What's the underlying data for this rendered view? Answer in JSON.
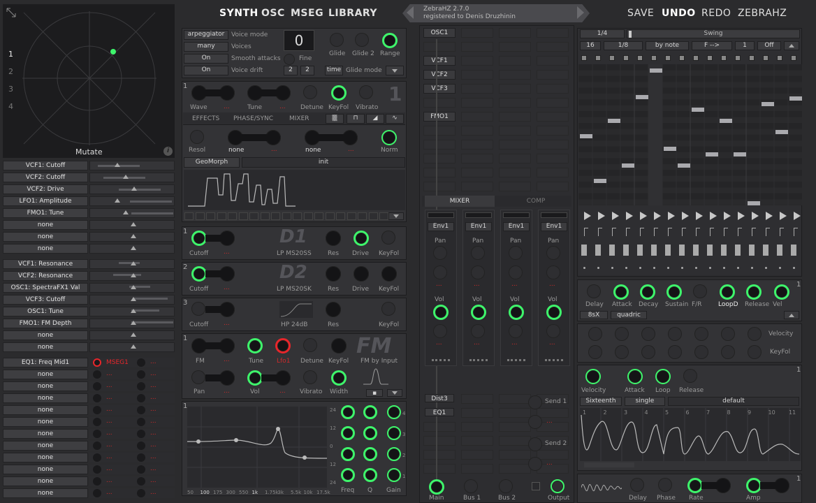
{
  "nav_left": [
    "SYNTH",
    "OSC",
    "MSEG",
    "LIBRARY"
  ],
  "version": "ZebraHZ 2.7.0",
  "registered": "registered to Denis Druzhinin",
  "nav_right": [
    "SAVE",
    "UNDO",
    "REDO",
    "ZEBRAHZ"
  ],
  "xy": {
    "numbers": [
      "1",
      "2",
      "3",
      "4"
    ],
    "label": "Mutate",
    "info": "i"
  },
  "mod_rows_a": [
    "VCF1: Cutoff",
    "VCF2: Cutoff",
    "VCF2: Drive",
    "LFO1: Amplitude",
    "FMO1: Tune",
    "none",
    "none",
    "none"
  ],
  "mod_rows_b": [
    "VCF1: Resonance",
    "VCF2: Resonance",
    "OSC1: SpectraFX1 Val",
    "VCF3: Cutoff",
    "OSC1: Tune",
    "FMO1: FM Depth",
    "none",
    "none"
  ],
  "mod_rows_c": [
    "EQ1: Freq Mid1",
    "none",
    "none",
    "none",
    "none",
    "none",
    "none",
    "none",
    "none",
    "none",
    "none",
    "none"
  ],
  "mod_c_src": "MSEG1",
  "dots": "...",
  "global": {
    "voice_mode_btn": "arpeggiator",
    "voice_mode": "Voice mode",
    "voices_btn": "many",
    "voices": "Voices",
    "smooth_btn": "On",
    "smooth": "Smooth attacks",
    "drift_btn": "On",
    "drift": "Voice drift",
    "transpose": "0",
    "glide": "Glide",
    "glide2": "Glide 2",
    "range": "Range",
    "fine": "Fine",
    "v1": "2",
    "v2": "2",
    "time_btn": "time",
    "glide_mode": "Glide mode"
  },
  "osc": {
    "num": "1",
    "wave": "Wave",
    "tune": "Tune",
    "detune": "Detune",
    "keyfol": "KeyFol",
    "vibrato": "Vibrato",
    "tabs": [
      "EFFECTS",
      "PHASE/SYNC",
      "MIXER"
    ],
    "resol": "Resol",
    "none1": "none",
    "none2": "none",
    "norm": "Norm",
    "geomorph": "GeoMorph",
    "init": "init"
  },
  "vcf1": {
    "num": "1",
    "cutoff": "Cutoff",
    "type": "LP MS20SS",
    "res": "Res",
    "drive": "Drive",
    "keyfol": "KeyFol",
    "logo": "D1"
  },
  "vcf2": {
    "num": "2",
    "cutoff": "Cutoff",
    "type": "LP MS20SK",
    "res": "Res",
    "drive": "Drive",
    "keyfol": "KeyFol",
    "logo": "D2"
  },
  "vcf3": {
    "num": "3",
    "cutoff": "Cutoff",
    "type": "HP 24dB",
    "res": "Res",
    "keyfol": "KeyFol"
  },
  "fmo": {
    "num": "1",
    "fm": "FM",
    "tune": "Tune",
    "lfo": "Lfo1",
    "detune": "Detune",
    "keyfol": "KeyFol",
    "logo": "FM",
    "by_input": "FM by Input",
    "pan": "Pan",
    "vol": "Vol",
    "vibrato": "Vibrato",
    "width": "Width"
  },
  "eq": {
    "num": "1",
    "freqs": [
      "50",
      "100",
      "175",
      "300",
      "550",
      "1k",
      "1.75k",
      "3k",
      "5.5k",
      "10k",
      "17.5k"
    ],
    "db": [
      "24",
      "12",
      "0",
      "12",
      "24"
    ],
    "freq": "Freq",
    "q": "Q",
    "gain": "Gain",
    "bands": [
      "4",
      "3",
      "2",
      "1"
    ]
  },
  "grid": {
    "labels": [
      "OSC1",
      "VCF1",
      "VCF2",
      "VCF3",
      "FMO1"
    ],
    "mixer": "MIXER",
    "comp": "COMP",
    "env": [
      "Env1",
      "Env1",
      "Env1",
      "Env1"
    ],
    "pan": "Pan",
    "vol": "Vol",
    "dist": "Dist3",
    "eq": "EQ1",
    "send1": "Send 1",
    "send2": "Send 2",
    "main": "Main",
    "bus1": "Bus 1",
    "bus2": "Bus 2",
    "output": "Output"
  },
  "arp": {
    "r1": [
      "1/4",
      "Swing"
    ],
    "r2": [
      "16",
      "1/8",
      "by note",
      "F -->",
      "1",
      "Off"
    ]
  },
  "env": {
    "num": "1",
    "labels": [
      "Delay",
      "Attack",
      "Decay",
      "Sustain",
      "F/R",
      "LoopD",
      "Release",
      "Vel"
    ],
    "btn1": "8sX",
    "btn2": "quadric"
  },
  "env_row2": {
    "velocity": "Velocity",
    "keyfol": "KeyFol"
  },
  "mseg": {
    "num": "1",
    "labels": [
      "Velocity",
      "Attack",
      "Loop",
      "Release"
    ],
    "b1": "Sixteenth",
    "b2": "single",
    "b3": "default",
    "nums": [
      "1",
      "2",
      "3",
      "4",
      "5",
      "6",
      "7",
      "8",
      "9",
      "10",
      "11"
    ]
  },
  "lfo": {
    "num": "1",
    "labels": [
      "Delay",
      "Phase",
      "Rate",
      "Amp"
    ]
  }
}
